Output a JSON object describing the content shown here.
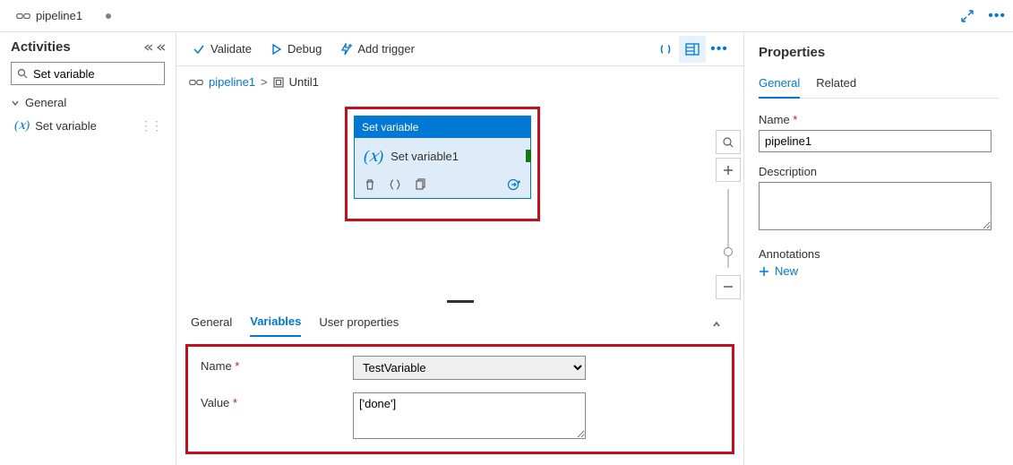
{
  "tabbar": {
    "title": "pipeline1"
  },
  "activities": {
    "title": "Activities",
    "search_value": "Set variable",
    "group": "General",
    "item": "Set variable"
  },
  "toolbar": {
    "validate": "Validate",
    "debug": "Debug",
    "add_trigger": "Add trigger"
  },
  "breadcrumb": {
    "root": "pipeline1",
    "sep": ">",
    "child": "Until1"
  },
  "card": {
    "header": "Set variable",
    "title": "Set variable1"
  },
  "bottom_tabs": {
    "general": "General",
    "variables": "Variables",
    "user_props": "User properties"
  },
  "form": {
    "name_label": "Name",
    "name_value": "TestVariable",
    "value_label": "Value",
    "value_value": "['done']"
  },
  "props": {
    "title": "Properties",
    "tab_general": "General",
    "tab_related": "Related",
    "name_label": "Name",
    "name_value": "pipeline1",
    "desc_label": "Description",
    "desc_value": "",
    "annot_label": "Annotations",
    "new_label": "New"
  }
}
